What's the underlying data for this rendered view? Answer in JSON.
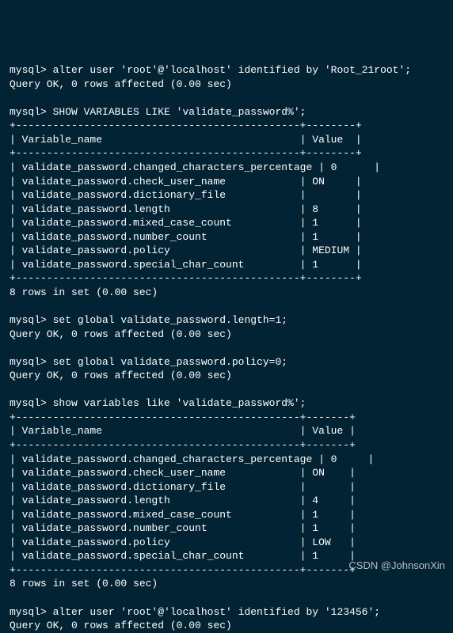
{
  "prompt": "mysql>",
  "query_ok": "Query OK, 0 rows affected (0.00 sec)",
  "rows_in_set": "8 rows in set (0.00 sec)",
  "blank": "",
  "cmd1": " alter user 'root'@'localhost' identified by 'Root_21root';",
  "cmd2": " SHOW VARIABLES LIKE 'validate_password%';",
  "cmd3": " set global validate_password.length=1;",
  "cmd4": " set global validate_password.policy=0;",
  "cmd5": " show variables like 'validate_password%';",
  "cmd6": " alter user 'root'@'localhost' identified by '123456';",
  "table1": {
    "border": "+----------------------------------------------+--------+",
    "header": "| Variable_name                                | Value  |",
    "rows": [
      "| validate_password.changed_characters_percentage | 0      |",
      "| validate_password.check_user_name            | ON     |",
      "| validate_password.dictionary_file            |        |",
      "| validate_password.length                     | 8      |",
      "| validate_password.mixed_case_count           | 1      |",
      "| validate_password.number_count               | 1      |",
      "| validate_password.policy                     | MEDIUM |",
      "| validate_password.special_char_count         | 1      |"
    ]
  },
  "table2": {
    "border": "+----------------------------------------------+-------+",
    "header": "| Variable_name                                | Value |",
    "rows": [
      "| validate_password.changed_characters_percentage | 0     |",
      "| validate_password.check_user_name            | ON    |",
      "| validate_password.dictionary_file            |       |",
      "| validate_password.length                     | 4     |",
      "| validate_password.mixed_case_count           | 1     |",
      "| validate_password.number_count               | 1     |",
      "| validate_password.policy                     | LOW   |",
      "| validate_password.special_char_count         | 1     |"
    ]
  },
  "watermark": "CSDN @JohnsonXin"
}
